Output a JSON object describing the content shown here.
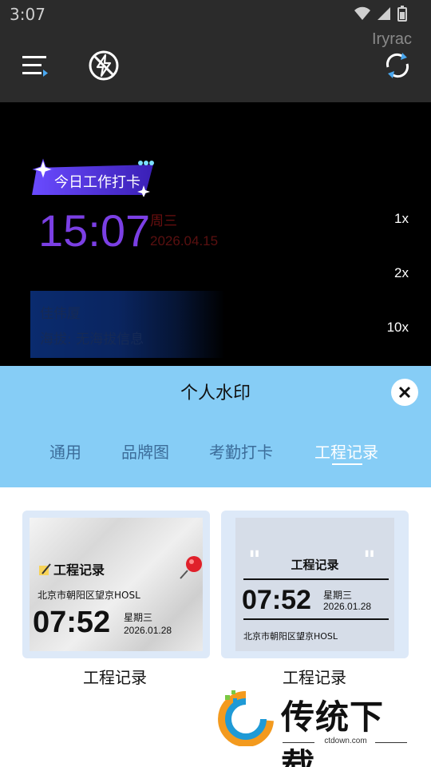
{
  "status_bar": {
    "time": "3:07"
  },
  "toolbar": {
    "user_tag": "Iryrac"
  },
  "watermark_preview": {
    "badge": "今日工作打卡",
    "time": "15:07",
    "weekday": "周三",
    "date": "2026.04.15",
    "name": "佳伟厦",
    "altitude": "海拔: 无海拔信息"
  },
  "zoom_levels": [
    "1x",
    "2x",
    "10x"
  ],
  "sheet": {
    "title": "个人水印",
    "tabs": [
      "通用",
      "品牌图",
      "考勤打卡",
      "工程记录"
    ],
    "active_tab": "工程记录"
  },
  "templates": [
    {
      "title": "工程记录",
      "address": "北京市朝阳区望京HOSL",
      "time": "07:52",
      "weekday": "星期三",
      "date": "2026.01.28",
      "label": "工程记录"
    },
    {
      "title": "工程记录",
      "address": "北京市朝阳区望京HOSL",
      "time": "07:52",
      "weekday": "星期三",
      "date": "2026.01.28",
      "label": "工程记录"
    }
  ],
  "brand_logo": {
    "name": "传统下载",
    "url": "ctdown.com"
  },
  "colors": {
    "sheet_header": "#86cdf6",
    "toolbar": "#2b2b2b",
    "accent_purple": "#7b3fe4"
  }
}
